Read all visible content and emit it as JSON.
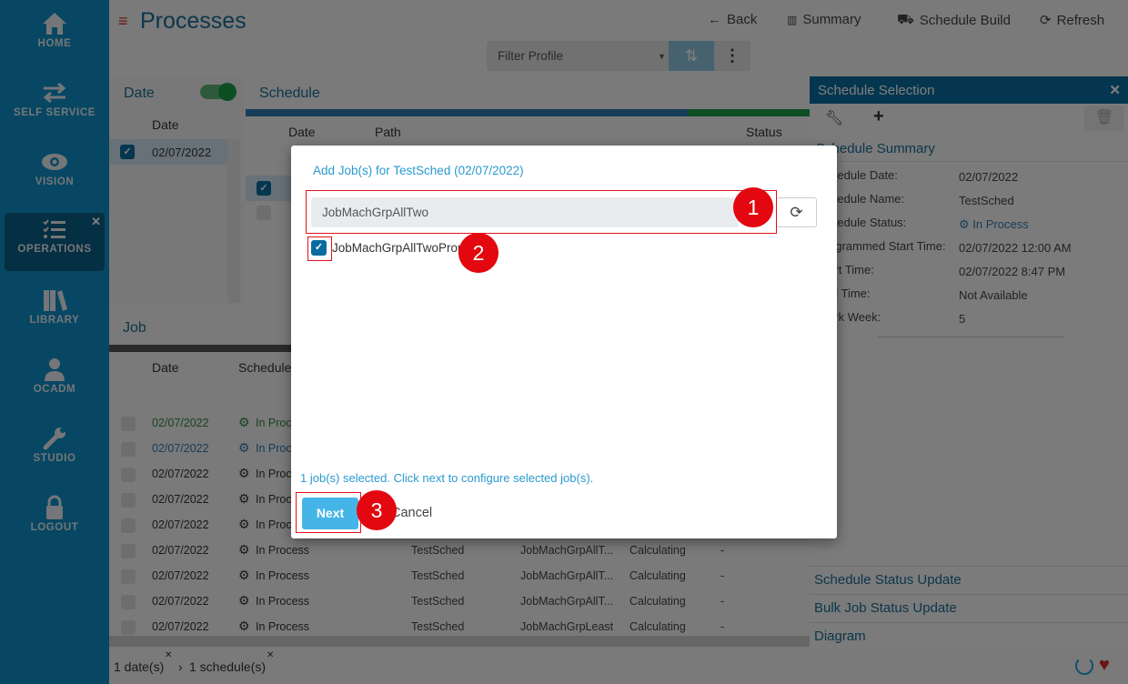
{
  "sidebar": {
    "items": [
      {
        "label": "HOME",
        "icon": "home-icon"
      },
      {
        "label": "SELF SERVICE",
        "icon": "swap-arrows-icon"
      },
      {
        "label": "VISION",
        "icon": "eye-icon"
      },
      {
        "label": "OPERATIONS",
        "icon": "tasks-icon",
        "active": true
      },
      {
        "label": "LIBRARY",
        "icon": "books-icon"
      },
      {
        "label": "OCADM",
        "icon": "user-icon"
      },
      {
        "label": "STUDIO",
        "icon": "wrench-icon"
      },
      {
        "label": "LOGOUT",
        "icon": "lock-icon"
      }
    ]
  },
  "header": {
    "title": "Processes",
    "buttons": {
      "back": "Back",
      "summary": "Summary",
      "schedule_build": "Schedule Build",
      "refresh": "Refresh"
    },
    "filter_profile": "Filter Profile"
  },
  "date_panel": {
    "title": "Date",
    "column": "Date",
    "rows": [
      "02/07/2022"
    ],
    "toggle_on": true
  },
  "schedule_panel": {
    "title": "Schedule",
    "columns": [
      "Date",
      "Path",
      "Status"
    ]
  },
  "job_panel": {
    "title": "Job",
    "columns": [
      "Date",
      "Schedule S"
    ],
    "rows": [
      {
        "date": "02/07/2022",
        "status": "In Process",
        "schedule": "",
        "job": "",
        "state": "",
        "extra": "",
        "color": "#2e8b3e"
      },
      {
        "date": "02/07/2022",
        "status": "In Process",
        "schedule": "",
        "job": "",
        "state": "",
        "extra": "",
        "color": "#2f7ab3"
      },
      {
        "date": "02/07/2022",
        "status": "In Process",
        "schedule": "",
        "job": "",
        "state": "",
        "extra": "",
        "color": "#333333"
      },
      {
        "date": "02/07/2022",
        "status": "In Process",
        "schedule": "",
        "job": "",
        "state": "",
        "extra": "",
        "color": "#333333"
      },
      {
        "date": "02/07/2022",
        "status": "In Process",
        "schedule": "",
        "job": "",
        "state": "",
        "extra": "",
        "color": "#333333"
      },
      {
        "date": "02/07/2022",
        "status": "In Process",
        "schedule": "TestSched",
        "job": "JobMachGrpAllT...",
        "state": "Calculating",
        "extra": "-",
        "color": "#333333"
      },
      {
        "date": "02/07/2022",
        "status": "In Process",
        "schedule": "TestSched",
        "job": "JobMachGrpAllT...",
        "state": "Calculating",
        "extra": "-",
        "color": "#333333"
      },
      {
        "date": "02/07/2022",
        "status": "In Process",
        "schedule": "TestSched",
        "job": "JobMachGrpAllT...",
        "state": "Calculating",
        "extra": "-",
        "color": "#333333"
      },
      {
        "date": "02/07/2022",
        "status": "In Process",
        "schedule": "TestSched",
        "job": "JobMachGrpLeast",
        "state": "Calculating",
        "extra": "-",
        "color": "#333333"
      }
    ]
  },
  "breadcrumb": {
    "dates": "1 date(s)",
    "schedules": "1 schedule(s)"
  },
  "right_panel": {
    "title": "Schedule Selection",
    "summary_title": "Schedule Summary",
    "fields": [
      {
        "label": "Schedule Date:",
        "value": "02/07/2022"
      },
      {
        "label": "Schedule Name:",
        "value": "TestSched"
      },
      {
        "label": "Schedule Status:",
        "value": "In Process"
      },
      {
        "label": "Programmed Start Time:",
        "value": "02/07/2022 12:00 AM"
      },
      {
        "label": "Start Time:",
        "value": "02/07/2022 8:47 PM"
      },
      {
        "label": "End Time:",
        "value": "Not Available"
      },
      {
        "label": "Work Week:",
        "value": "5"
      }
    ],
    "accordions": [
      "Schedule Status Update",
      "Bulk Job Status Update",
      "Diagram"
    ]
  },
  "modal": {
    "title": "Add Job(s) for TestSched (02/07/2022)",
    "search_value": "JobMachGrpAllTwo",
    "items": [
      {
        "label": "JobMachGrpAllTwoProp",
        "checked": true
      }
    ],
    "status": "1 job(s) selected. Click next to configure selected job(s).",
    "next": "Next",
    "cancel": "Cancel"
  },
  "annotations": [
    "1",
    "2",
    "3"
  ],
  "colors": {
    "sidebar": "#0f8fc7",
    "accent": "#0a6c9e",
    "annotation": "#e3070f",
    "next_button": "#45b5e8"
  }
}
